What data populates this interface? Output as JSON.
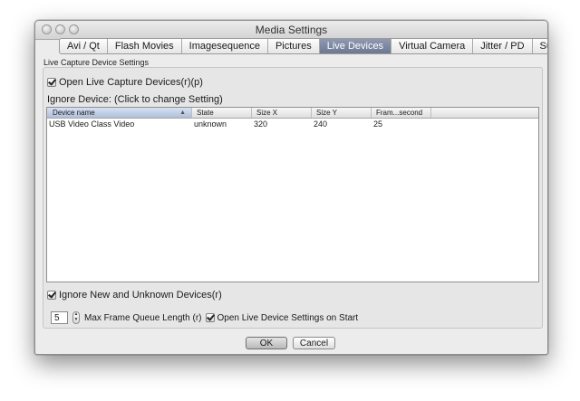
{
  "window": {
    "title": "Media Settings"
  },
  "tabs": [
    {
      "label": "Avi / Qt"
    },
    {
      "label": "Flash Movies"
    },
    {
      "label": "Imagesequence"
    },
    {
      "label": "Pictures"
    },
    {
      "label": "Live Devices"
    },
    {
      "label": "Virtual Camera"
    },
    {
      "label": "Jitter / PD"
    },
    {
      "label": "Supertitle Text"
    }
  ],
  "active_tab": "Live Devices",
  "section": {
    "label": "Live Capture Device Settings",
    "open_live_label": "Open Live Capture Devices(r)(p)",
    "open_live_checked": true,
    "ignore_device_label": "Ignore Device: (Click to change Setting)",
    "ignore_new_label": "Ignore New and Unknown Devices(r)",
    "ignore_new_checked": true,
    "max_queue_value": "5",
    "max_queue_label": "Max Frame Queue Length (r)",
    "open_settings_label": "Open Live Device Settings on Start",
    "open_settings_checked": true
  },
  "table": {
    "columns": [
      "Device name",
      "State",
      "Size X",
      "Size Y",
      "Fram...second",
      ""
    ],
    "sorted_column": "Device name",
    "sort_icon": "sort-ascending-icon",
    "rows": [
      {
        "device_name": "USB Video Class Video",
        "state": "unknown",
        "size_x": "320",
        "size_y": "240",
        "fps": "25"
      }
    ]
  },
  "buttons": {
    "ok": "OK",
    "cancel": "Cancel"
  },
  "colors": {
    "active_tab": "#7b86a0",
    "window_bg": "#ececec"
  }
}
